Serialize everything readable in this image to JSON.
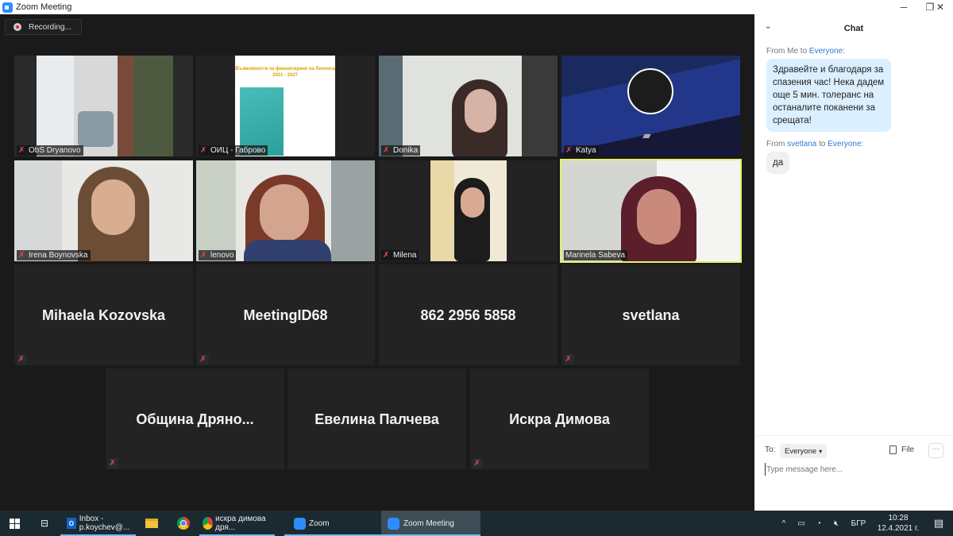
{
  "window": {
    "title": "Zoom Meeting",
    "minimize": "─",
    "maximize": "❐",
    "close": "✕"
  },
  "recording": {
    "label": "Recording..."
  },
  "video_tiles": [
    {
      "name": "ObS Dryanovo",
      "muted": true
    },
    {
      "name": "ОИЦ - Габрово",
      "muted": true,
      "slide_title": "Възможности за финансиране на бизнеса",
      "slide_years": "2021 - 2027"
    },
    {
      "name": "Donika",
      "muted": true
    },
    {
      "name": "Katya",
      "muted": true,
      "video_off": true
    },
    {
      "name": "Irena Boynovska",
      "muted": true
    },
    {
      "name": "lenovo",
      "muted": true
    },
    {
      "name": "Milena",
      "muted": true
    },
    {
      "name": "Marinela Sabeva",
      "muted": false,
      "active_speaker": true
    }
  ],
  "name_tiles": [
    {
      "name": "Mihaela Kozovska",
      "muted": true
    },
    {
      "name": "MeetingID68",
      "muted": true
    },
    {
      "name": "862 2956 5858",
      "muted": false
    },
    {
      "name": "svetlana",
      "muted": true
    },
    {
      "name": "Община  Дряно...",
      "muted": true
    },
    {
      "name": "Евелина Палчева",
      "muted": false
    },
    {
      "name": "Искра Димова",
      "muted": true
    }
  ],
  "chat": {
    "title": "Chat",
    "messages": [
      {
        "from": "Me",
        "to": "Everyone",
        "from_prefix": "From ",
        "to_prefix": " to ",
        "suffix": ":",
        "text": "Здравейте и благодаря за спазения час! Нека дадем още 5 мин. толеранс на останалите поканени за срещата!"
      },
      {
        "from": "svetlana",
        "to": "Everyone",
        "from_prefix": "From ",
        "to_prefix": " to ",
        "suffix": ":",
        "text": "да"
      }
    ],
    "to_label": "To:",
    "recipient": "Everyone",
    "file_label": "File",
    "more_label": "···",
    "input_placeholder": "Type message here..."
  },
  "taskbar": {
    "items": [
      {
        "label": "Inbox - p.koychev@..."
      },
      {
        "label": "искра димова дря..."
      },
      {
        "label": "Zoom"
      },
      {
        "label": "Zoom Meeting"
      }
    ],
    "tray": {
      "language": "БГР",
      "time": "10:28",
      "date": "12.4.2021 г."
    }
  }
}
